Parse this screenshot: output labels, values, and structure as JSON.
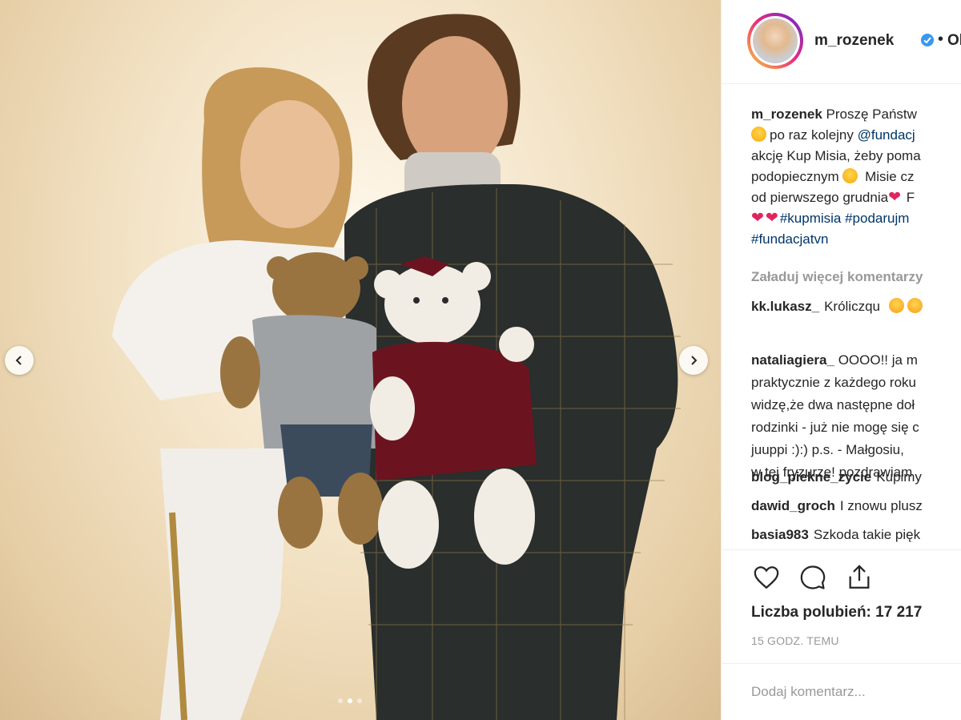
{
  "post": {
    "username": "m_rozenek",
    "follow_dot": "•",
    "follow_label": "Ob",
    "caption_lines": [
      {
        "user": "m_rozenek",
        "text": " Proszę Państw"
      },
      {
        "text": "po raz kolejny ",
        "tag": "@fundacj"
      },
      {
        "text": "akcję Kup Misia, żeby poma"
      },
      {
        "text": "podopiecznym ",
        "text2": " Misie cz"
      },
      {
        "text": "od pierwszego grudnia",
        "text2": " F"
      },
      {
        "tags": "#kupmisia #podarujm"
      },
      {
        "tags": "#fundacjatvn"
      }
    ],
    "load_more": "Załaduj więcej komentarzy",
    "comments": [
      {
        "user": "kk.lukasz_",
        "text": "Króliczqu"
      },
      {
        "user": "nataliagiera_",
        "lines": [
          "OOOO!! ja m",
          "praktycznie z każdego roku",
          "widzę,że dwa następne doł",
          "rodzinki - już nie mogę się c",
          "juuppi :):) p.s. - Małgosiu,",
          "w tej fryzurze! pozdrawiam"
        ]
      },
      {
        "user": "blog_piekne_zycie",
        "text": "Kupimy"
      },
      {
        "user": "dawid_groch",
        "text": "I znowu plusz"
      },
      {
        "user": "basia983",
        "text": "Szkoda takie pięk"
      }
    ],
    "likes": "Liczba polubień: 17 217",
    "timestamp": "15 GODZ. TEMU",
    "comment_placeholder": "Dodaj komentarz..."
  },
  "colors": {
    "text": "#262626",
    "muted": "#999999",
    "link": "#003569",
    "verified": "#3897f0"
  },
  "icons": [
    "chevron-left-icon",
    "chevron-right-icon",
    "verified-icon",
    "heart-icon",
    "comment-icon",
    "share-icon"
  ]
}
